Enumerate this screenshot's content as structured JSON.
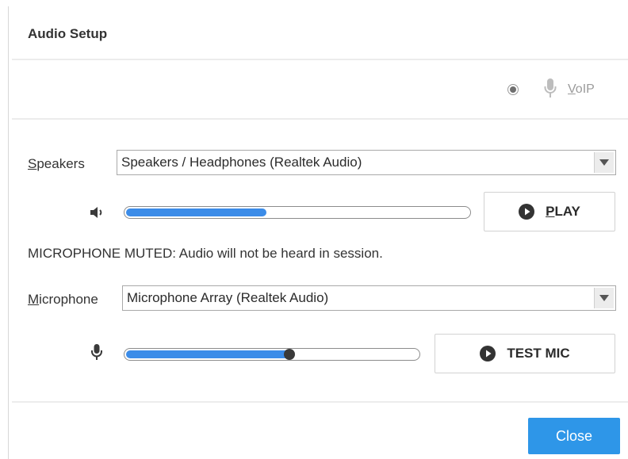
{
  "dialog": {
    "title": "Audio Setup",
    "voip": {
      "label_mnemonic": "V",
      "label_rest": "oIP",
      "selected": true
    }
  },
  "speakers": {
    "label_mnemonic": "S",
    "label_rest": "peakers",
    "selected": "Speakers / Headphones (Realtek Audio)",
    "volume_level": 0.41,
    "play_button": {
      "mnemonic": "P",
      "rest": "LAY"
    }
  },
  "microphone": {
    "status_message": "MICROPHONE MUTED: Audio will not be heard in session.",
    "label_mnemonic": "M",
    "label_rest": "icrophone",
    "selected": "Microphone Array (Realtek Audio)",
    "level": 0.56,
    "test_button": "TEST MIC"
  },
  "footer": {
    "close_label": "Close"
  },
  "colors": {
    "accent": "#2e96e8",
    "slider_fill": "#3b8ce8",
    "thumb": "#3a3a3a"
  },
  "icons": [
    "mic-icon",
    "speaker-icon",
    "play-icon",
    "dropdown-arrow-icon"
  ]
}
